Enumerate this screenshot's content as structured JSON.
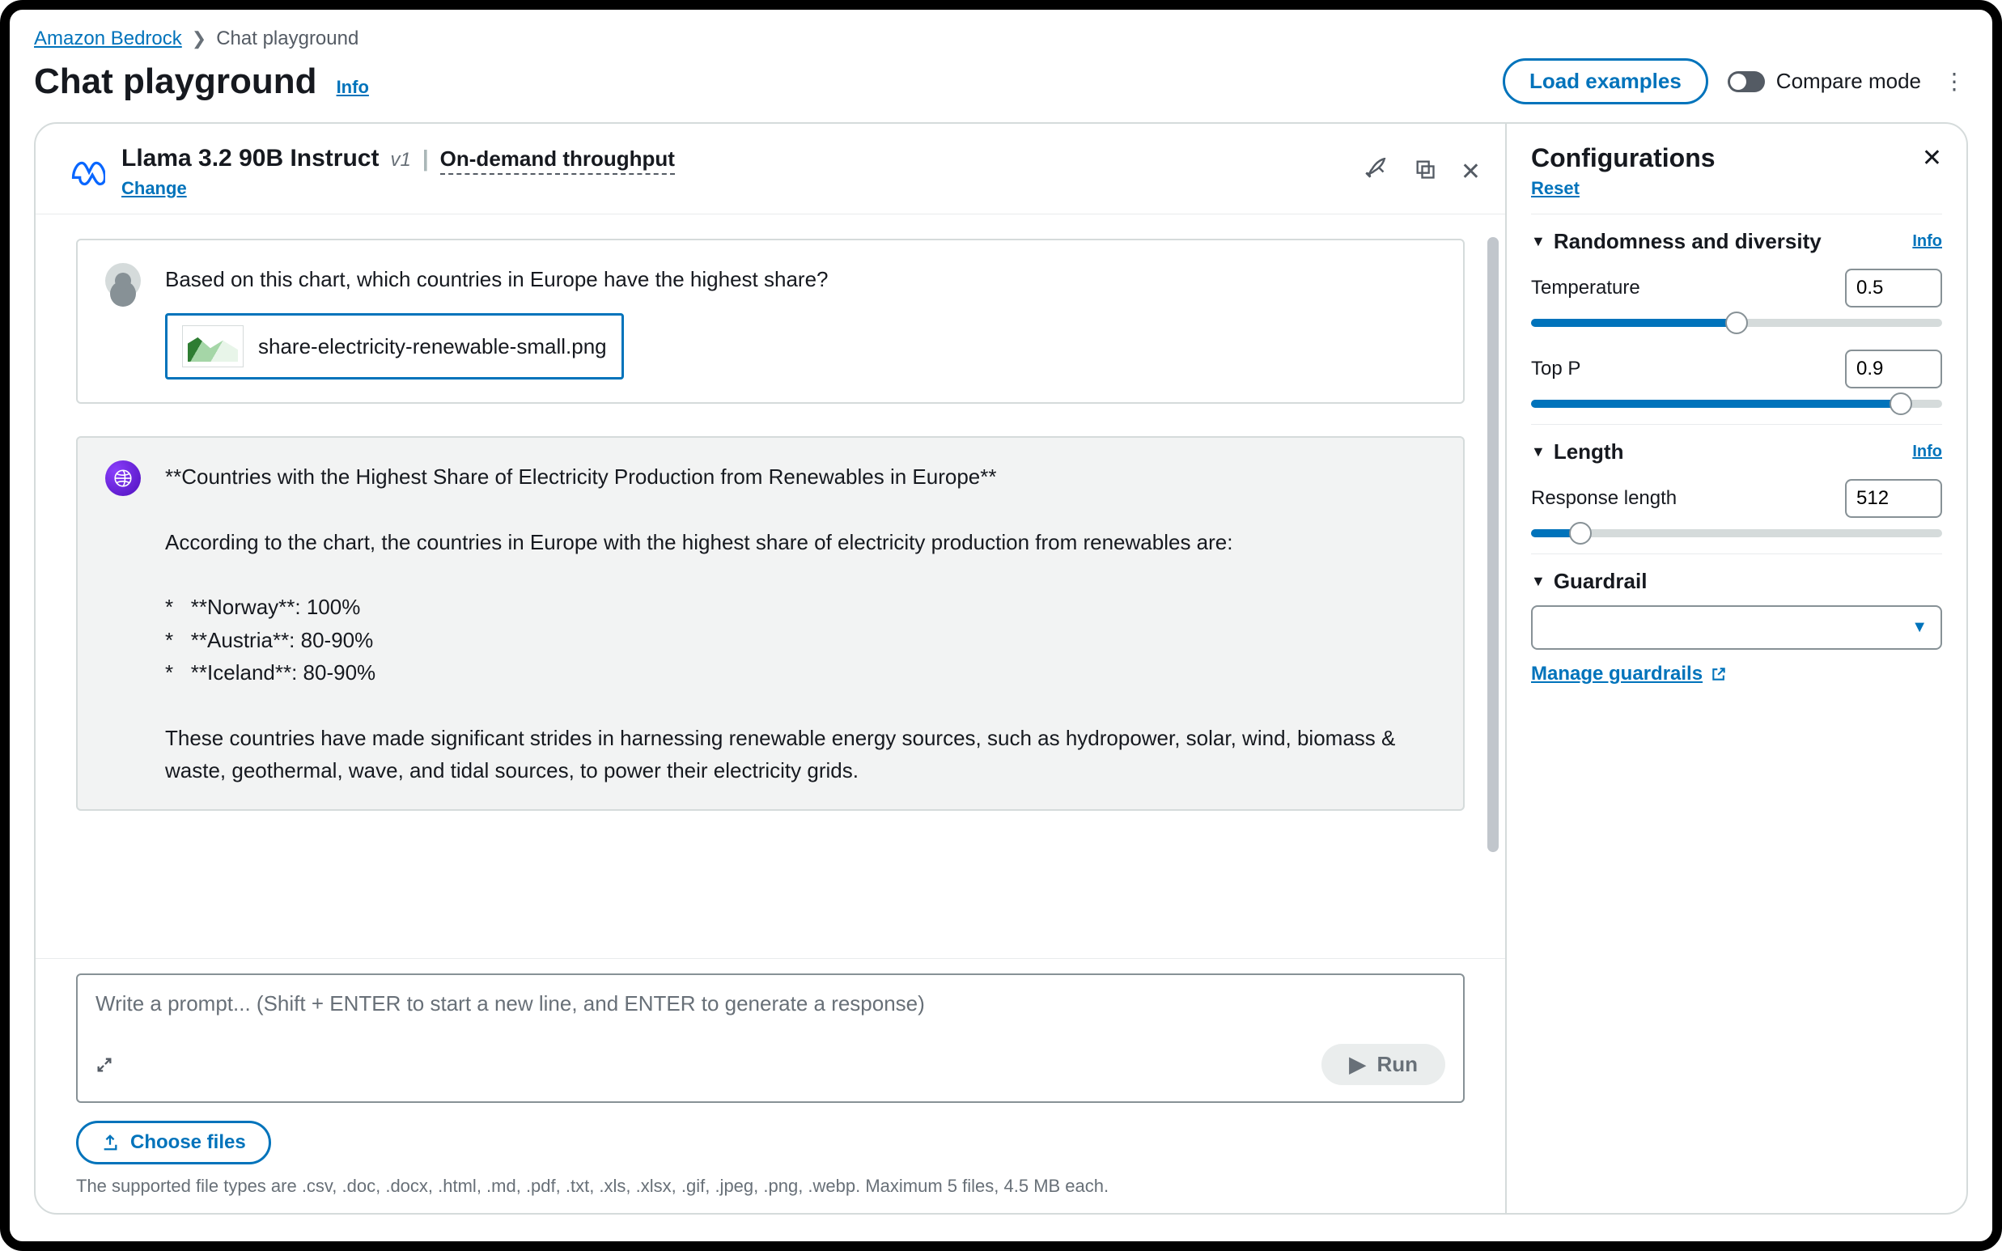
{
  "breadcrumb": {
    "root": "Amazon Bedrock",
    "current": "Chat playground"
  },
  "page": {
    "title": "Chat playground",
    "info": "Info"
  },
  "header_actions": {
    "load_examples": "Load examples",
    "compare_mode": "Compare mode"
  },
  "model": {
    "name": "Llama 3.2 90B Instruct",
    "version": "v1",
    "throughput": "On-demand throughput",
    "change": "Change"
  },
  "chat": {
    "user_text": "Based on this chart, which countries in Europe have the highest share?",
    "attachment_name": "share-electricity-renewable-small.png",
    "ai_text": "**Countries with the Highest Share of Electricity Production from Renewables in Europe**\n\nAccording to the chart, the countries in Europe with the highest share of electricity production from renewables are:\n\n*   **Norway**: 100%\n*   **Austria**: 80-90%\n*   **Iceland**: 80-90%\n\nThese countries have made significant strides in harnessing renewable energy sources, such as hydropower, solar, wind, biomass & waste, geothermal, wave, and tidal sources, to power their electricity grids."
  },
  "prompt": {
    "placeholder": "Write a prompt... (Shift + ENTER to start a new line, and ENTER to generate a response)",
    "run": "Run",
    "choose_files": "Choose files",
    "hint": "The supported file types are .csv, .doc, .docx, .html, .md, .pdf, .txt, .xls, .xlsx, .gif, .jpeg, .png, .webp. Maximum 5 files, 4.5 MB each."
  },
  "config": {
    "title": "Configurations",
    "reset": "Reset",
    "randomness": {
      "label": "Randomness and diversity",
      "info": "Info",
      "temperature_label": "Temperature",
      "temperature_value": "0.5",
      "top_p_label": "Top P",
      "top_p_value": "0.9"
    },
    "length": {
      "label": "Length",
      "info": "Info",
      "response_label": "Response length",
      "response_value": "512"
    },
    "guardrail": {
      "label": "Guardrail",
      "selected": "",
      "manage": "Manage guardrails"
    }
  }
}
